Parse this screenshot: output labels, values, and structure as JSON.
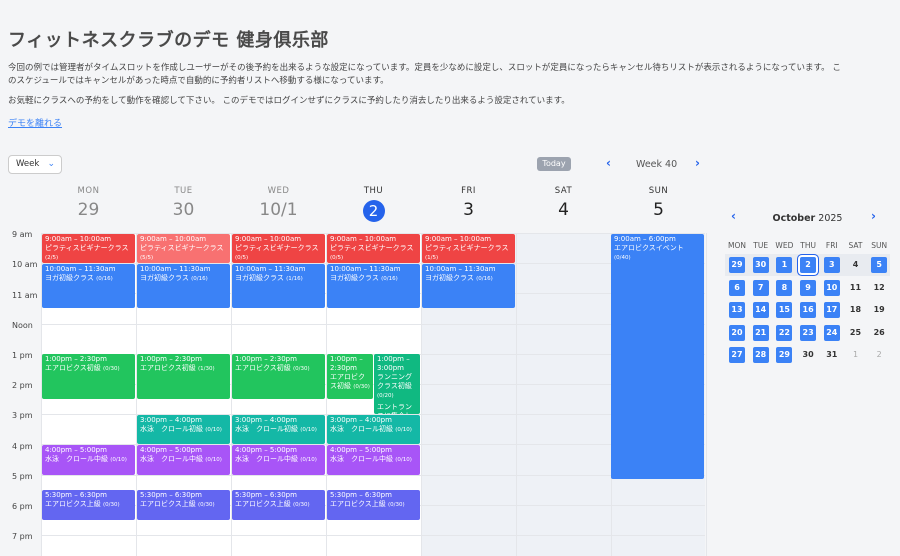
{
  "header": {
    "title": "フィットネスクラブのデモ 健身俱乐部",
    "desc1_line1": "今回の例では管理者がタイムスロットを作成しユーザーがその後予約を出来るような設定になっています。定員を少なめに設定し、スロットが定員になったらキャンセル待ちリストが表示されるようになっています。 こ",
    "desc1_line2": "のスケジュールではキャンセルがあった時点で自動的に予約者リストへ移動する様になっています。",
    "desc2": "お気軽にクラスへの予約をして動作を確認して下さい。 このデモではログインせずにクラスに予約したり消去したり出来るよう設定されています。",
    "leave_link": "デモを離れる"
  },
  "toolbar": {
    "view_select": "Week",
    "today": "Today",
    "week_label": "Week 40",
    "prev_icon": "chevron-left-icon",
    "next_icon": "chevron-right-icon"
  },
  "days": [
    {
      "name": "MON",
      "num": "29"
    },
    {
      "name": "TUE",
      "num": "30"
    },
    {
      "name": "WED",
      "num": "10/1"
    },
    {
      "name": "THU",
      "num": "2"
    },
    {
      "name": "FRI",
      "num": "3"
    },
    {
      "name": "SAT",
      "num": "4"
    },
    {
      "name": "SUN",
      "num": "5"
    }
  ],
  "times": [
    "9 am",
    "10 am",
    "11 am",
    "Noon",
    "1 pm",
    "2 pm",
    "3 pm",
    "4 pm",
    "5 pm",
    "6 pm",
    "7 pm"
  ],
  "events": {
    "pilates": {
      "time": "9:00am – 10:00am",
      "name": "ピラティスビギナークラス"
    },
    "pilates_caps": [
      "(2/5)",
      "(5/5)",
      "(0/5)",
      "(0/5)",
      "(1/5)"
    ],
    "yoga": {
      "time": "10:00am – 11:30am",
      "name": "ヨガ初級クラス"
    },
    "yoga_caps": [
      "(0/16)",
      "(0/16)",
      "(1/16)",
      "(0/16)",
      "(0/16)"
    ],
    "aero_beg": {
      "time": "1:00pm – 2:30pm",
      "name": "エアロビクス初級"
    },
    "aero_beg_caps": [
      "(0/30)",
      "(1/30)",
      "(0/30)",
      "(0/30)"
    ],
    "thu_aero_time": "1:00pm – 2:30pm",
    "thu_aero_name": "エアロビクス初級",
    "running": {
      "time": "1:00pm – 3:00pm",
      "name": "ランニングクラス初級",
      "cap": "(0/20)",
      "note": "エントランスに集合して下さい。"
    },
    "swim_beg": {
      "time": "3:00pm – 4:00pm",
      "name": "水泳　クロール初級"
    },
    "swim_beg_caps": [
      "(0/10)",
      "(0/10)",
      "(0/10)"
    ],
    "swim_mid": {
      "time": "4:00pm – 5:00pm",
      "name": "水泳　クロール中級"
    },
    "swim_mid_caps": [
      "(0/10)",
      "(0/10)",
      "(0/10)",
      "(0/10)"
    ],
    "aero_adv": {
      "time": "5:30pm – 6:30pm",
      "name": "エアロビクス上級"
    },
    "aero_adv_caps": [
      "(0/30)",
      "(0/30)",
      "(0/30)",
      "(0/30)"
    ],
    "sun_event": {
      "time": "9:00am – 6:00pm",
      "name": "エアロビクスイベント",
      "cap": "(0/40)"
    }
  },
  "mini_calendar": {
    "month": "October",
    "year": "2025",
    "dow": [
      "MON",
      "TUE",
      "WED",
      "THU",
      "FRI",
      "SAT",
      "SUN"
    ],
    "weeks": [
      [
        "29",
        "30",
        "1",
        "2",
        "3",
        "4",
        "5"
      ],
      [
        "6",
        "7",
        "8",
        "9",
        "10",
        "11",
        "12"
      ],
      [
        "13",
        "14",
        "15",
        "16",
        "17",
        "18",
        "19"
      ],
      [
        "20",
        "21",
        "22",
        "23",
        "24",
        "25",
        "26"
      ],
      [
        "27",
        "28",
        "29",
        "30",
        "31",
        "1",
        "2"
      ]
    ]
  },
  "colors": {
    "accent": "#2563eb",
    "pilates": "#ef4444",
    "yoga": "#3b82f6",
    "aerobics_beginner": "#22c55e",
    "swim_beginner": "#14b8a6",
    "swim_intermediate": "#a855f7",
    "aerobics_advanced": "#6366f1"
  }
}
